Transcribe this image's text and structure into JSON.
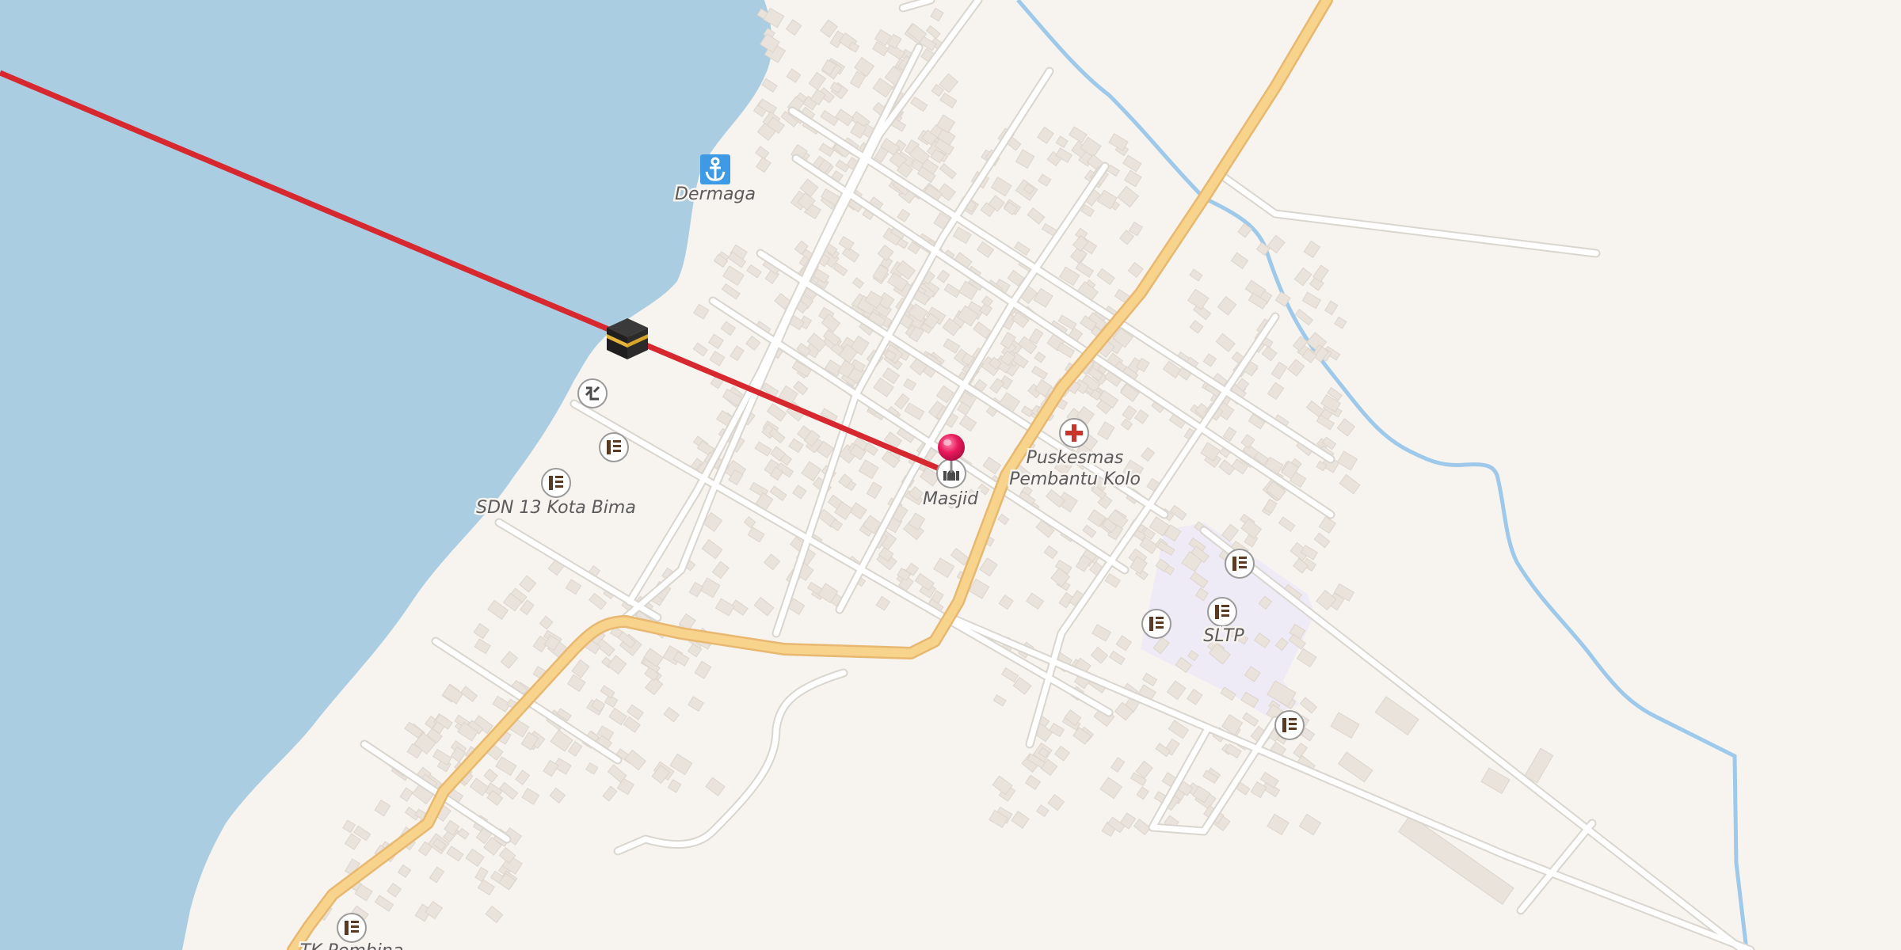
{
  "map": {
    "colors": {
      "water": "#abcde2",
      "land": "#f7f4f0",
      "road_major": "#f7d38c",
      "road_major_casing": "#e9b870",
      "road_minor": "#ffffff",
      "road_minor_casing": "#d9d5cf",
      "building": "#e9e3dc",
      "stream": "#9ec9ea",
      "qibla_line": "#d7282f",
      "pin": "#e8195b",
      "school_area": "#ece9f6"
    },
    "qibla": {
      "icon": "kaaba-icon"
    },
    "labels": {
      "harbor": "Dermaga",
      "school_sdn": "SDN 13 Kota Bima",
      "mosque": "Masjid",
      "clinic_line1": "Puskesmas",
      "clinic_line2": "Pembantu Kolo",
      "school_sltp": "SLTP",
      "kindergarten": "TK Pembina"
    },
    "pois": [
      {
        "name": "harbor",
        "icon": "anchor-icon"
      },
      {
        "name": "clinic",
        "icon": "medical-cross-icon"
      },
      {
        "name": "mosque",
        "icon": "mosque-icon"
      },
      {
        "name": "school",
        "icon": "school-icon"
      },
      {
        "name": "shelter",
        "icon": "shelter-icon"
      },
      {
        "name": "location-pin",
        "icon": "pin-icon"
      }
    ]
  }
}
